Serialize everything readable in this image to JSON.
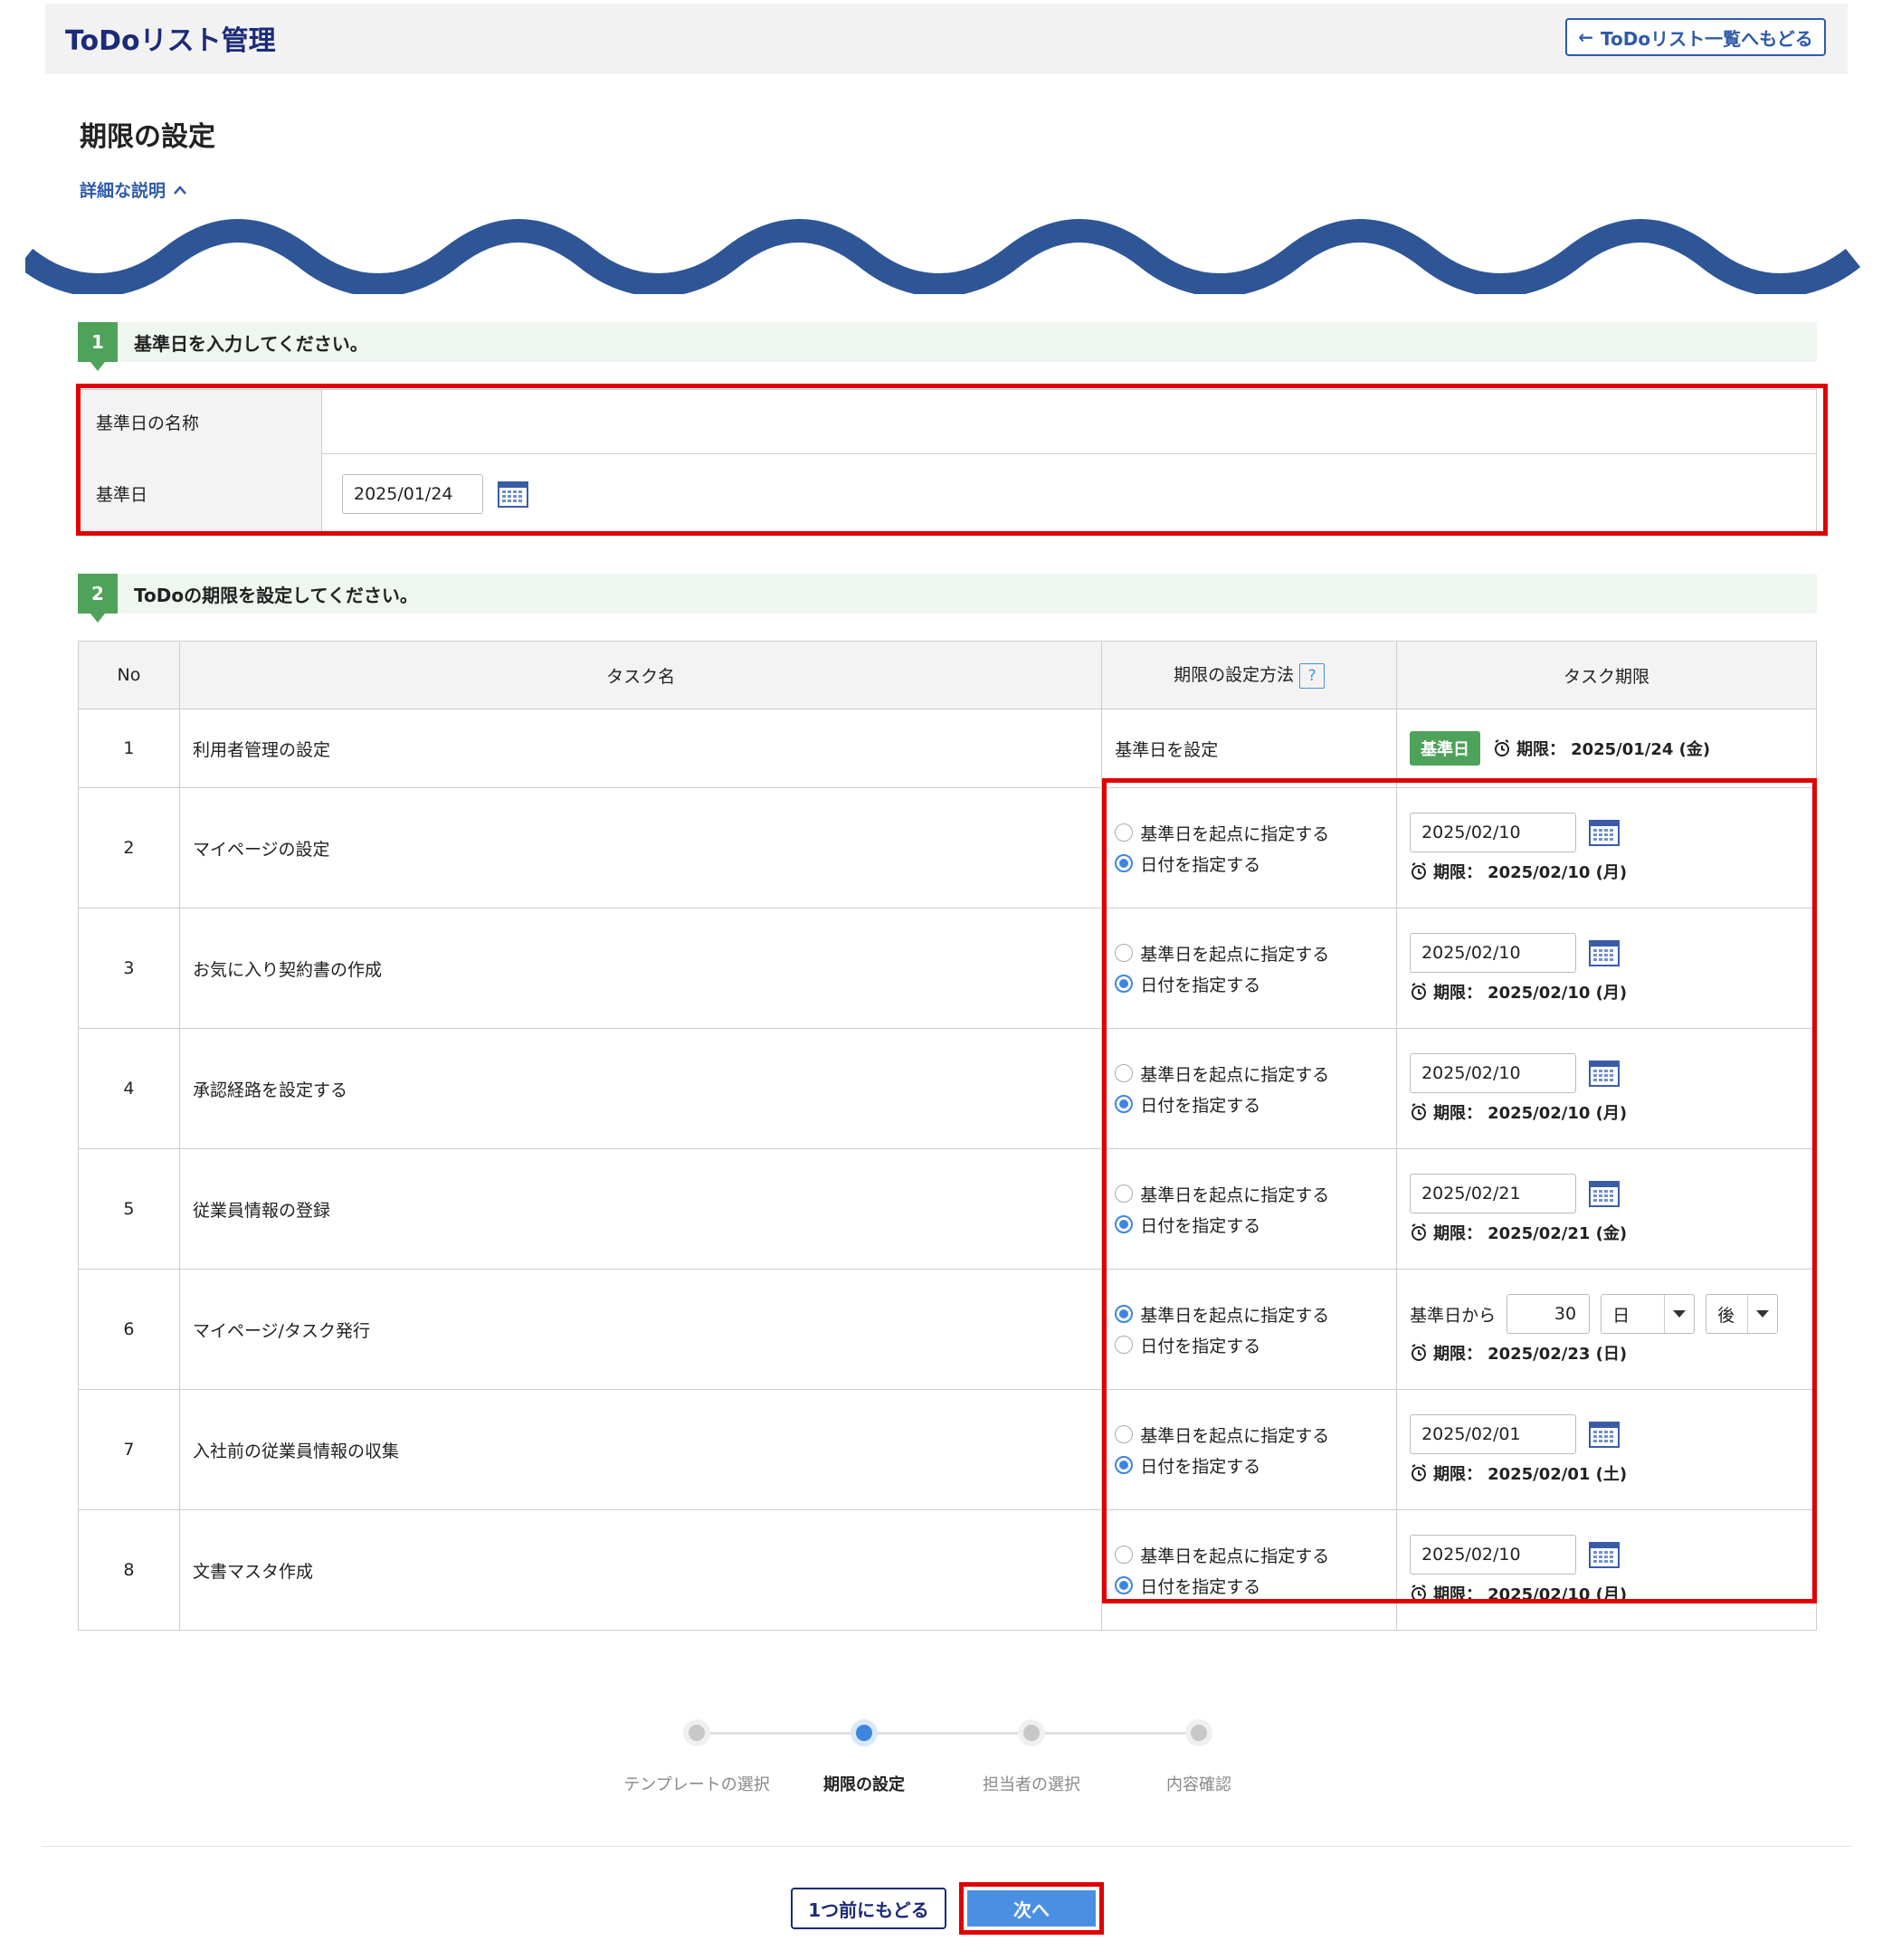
{
  "header": {
    "app_title": "ToDoリスト管理",
    "back_label": "ToDoリスト一覧へもどる"
  },
  "page": {
    "title": "期限の設定",
    "detail_link": "詳細な説明"
  },
  "section1": {
    "num": "1",
    "heading": "基準日を入力してください。",
    "name_label": "基準日の名称",
    "name_value": "",
    "date_label": "基準日",
    "date_value": "2025/01/24"
  },
  "section2": {
    "num": "2",
    "heading": "ToDoの期限を設定してください。",
    "columns": {
      "no": "No",
      "task": "タスク名",
      "method": "期限の設定方法",
      "deadline": "タスク期限"
    },
    "help_mark": "?",
    "option_base": "基準日を起点に指定する",
    "option_date": "日付を指定する",
    "deadline_prefix": "期限：",
    "base_tag": "基準日",
    "rows": [
      {
        "no": "1",
        "task": "利用者管理の設定",
        "method_text": "基準日を設定",
        "deadline": "2025/01/24 (金)"
      },
      {
        "no": "2",
        "task": "マイページの設定",
        "input": "2025/02/10",
        "deadline": "2025/02/10 (月)"
      },
      {
        "no": "3",
        "task": "お気に入り契約書の作成",
        "input": "2025/02/10",
        "deadline": "2025/02/10 (月)"
      },
      {
        "no": "4",
        "task": "承認経路を設定する",
        "input": "2025/02/10",
        "deadline": "2025/02/10 (月)"
      },
      {
        "no": "5",
        "task": "従業員情報の登録",
        "input": "2025/02/21",
        "deadline": "2025/02/21 (金)"
      },
      {
        "no": "6",
        "task": "マイページ/タスク発行",
        "relative_label": "基準日から",
        "relative_value": "30",
        "unit": "日",
        "direction": "後",
        "deadline": "2025/02/23 (日)"
      },
      {
        "no": "7",
        "task": "入社前の従業員情報の収集",
        "input": "2025/02/01",
        "deadline": "2025/02/01 (土)"
      },
      {
        "no": "8",
        "task": "文書マスタ作成",
        "input": "2025/02/10",
        "deadline": "2025/02/10 (月)"
      }
    ]
  },
  "stepper": {
    "steps": [
      "テンプレートの選択",
      "期限の設定",
      "担当者の選択",
      "内容確認"
    ],
    "active_index": 1
  },
  "footer": {
    "prev_label": "1つ前にもどる",
    "next_label": "次へ"
  },
  "colors": {
    "accent_blue": "#2e5ba8",
    "green": "#4ea25a",
    "highlight_red": "#e00000",
    "radio_blue": "#3d85e0"
  }
}
